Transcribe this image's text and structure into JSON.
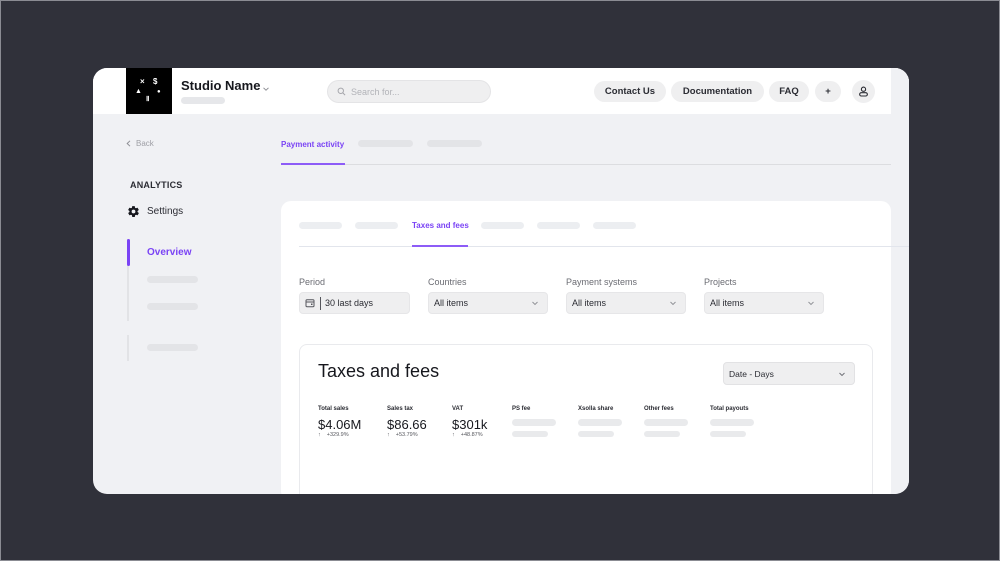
{
  "header": {
    "studio_name": "Studio Name",
    "logo_glyphs": [
      "×",
      "$",
      "▲",
      "●",
      "Ⅱ"
    ],
    "search": {
      "placeholder": "Search for...",
      "value": ""
    },
    "buttons": {
      "contact": "Contact Us",
      "documentation": "Documentation",
      "faq": "FAQ",
      "add": "+"
    },
    "icons": {
      "search": "search-icon",
      "chevron": "chevron-down-icon",
      "user": "user-icon"
    }
  },
  "sidebar": {
    "back_label": "Back",
    "section_title": "ANALYTICS",
    "settings_label": "Settings",
    "items": [
      {
        "label": "Overview",
        "active": true
      },
      {
        "label": "",
        "placeholder": true
      },
      {
        "label": "",
        "placeholder": true
      },
      {
        "label": "",
        "placeholder": true
      }
    ]
  },
  "top_tabs": [
    {
      "label": "Payment activity",
      "active": true
    },
    {
      "label": "",
      "placeholder": true
    },
    {
      "label": "",
      "placeholder": true
    }
  ],
  "sub_tabs": [
    {
      "label": "",
      "placeholder": true
    },
    {
      "label": "",
      "placeholder": true
    },
    {
      "label": "Taxes and fees",
      "active": true
    },
    {
      "label": "",
      "placeholder": true
    },
    {
      "label": "",
      "placeholder": true
    },
    {
      "label": "",
      "placeholder": true
    }
  ],
  "filters": [
    {
      "label": "Period",
      "value": "30 last days",
      "icon": "calendar-icon"
    },
    {
      "label": "Countries",
      "value": "All items"
    },
    {
      "label": "Payment systems",
      "value": "All items"
    },
    {
      "label": "Projects",
      "value": "All items"
    }
  ],
  "card": {
    "title": "Taxes and fees",
    "grouping": "Date - Days",
    "metrics": [
      {
        "label": "Total sales",
        "value": "$4.06M",
        "delta": "+329.9%",
        "trend": "up"
      },
      {
        "label": "Sales tax",
        "value": "$86.66",
        "delta": "+53.79%",
        "trend": "up"
      },
      {
        "label": "VAT",
        "value": "$301k",
        "delta": "+48.87%",
        "trend": "up"
      },
      {
        "label": "PS fee",
        "value": null,
        "loading": true
      },
      {
        "label": "Xsolla share",
        "value": null,
        "loading": true
      },
      {
        "label": "Other fees",
        "value": null,
        "loading": true
      },
      {
        "label": "Total payouts",
        "value": null,
        "loading": true
      }
    ]
  },
  "colors": {
    "accent": "#7a43f5",
    "background": "#30313a",
    "surface": "#f0f1f4",
    "panel": "#ffffff"
  }
}
